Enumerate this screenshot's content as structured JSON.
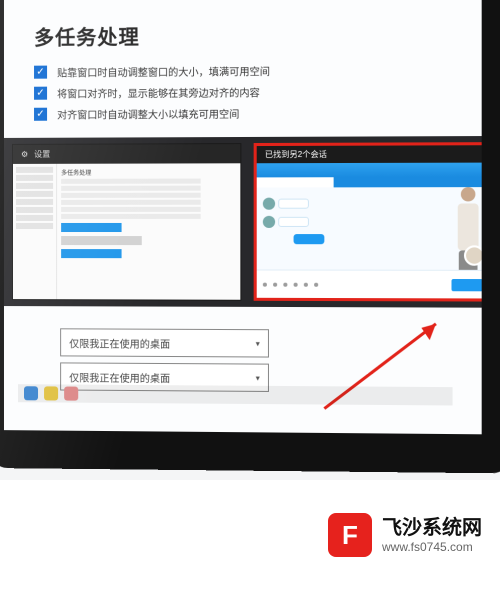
{
  "page": {
    "title": "多任务处理"
  },
  "options": {
    "o1": "贴靠窗口时自动调整窗口的大小，填满可用空间",
    "o2": "将窗口对齐时，显示能够在其旁边对齐的内容",
    "o3": "对齐窗口时自动调整大小以填充可用空间"
  },
  "snap": {
    "left_title": "设置",
    "left_heading": "多任务处理",
    "right_title": "已找到另2个会话"
  },
  "dropdown": {
    "d1": "仅限我正在使用的桌面",
    "d2": "仅限我正在使用的桌面"
  },
  "watermark": {
    "logo_letter": "F",
    "title": "飞沙系统网",
    "url": "www.fs0745.com"
  }
}
